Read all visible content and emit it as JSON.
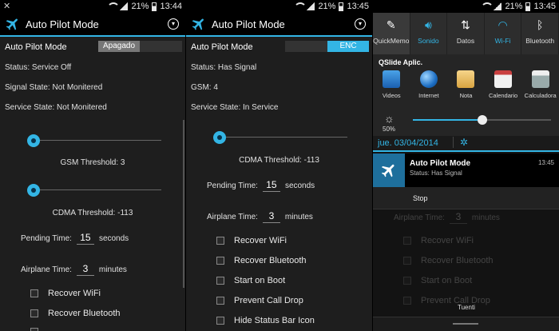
{
  "colors": {
    "accent": "#33b5e5",
    "background": "#1e1e1e"
  },
  "panel1": {
    "status": {
      "battery": "21%",
      "time": "13:44"
    },
    "title": "Auto Pilot Mode",
    "mode_label": "Auto Pilot Mode",
    "toggle": "Apagado",
    "status_line": "Status: Service Off",
    "signal_state": "Signal State: Not Monitered",
    "service_state": "Service State: Not Monitered",
    "gsm_threshold": "GSM Threshold: 3",
    "cdma_threshold": "CDMA Threshold: -113",
    "pending_label": "Pending Time:",
    "pending_value": "15",
    "pending_unit": "seconds",
    "airplane_label": "Airplane Time:",
    "airplane_value": "3",
    "airplane_unit": "minutes",
    "checks": [
      "Recover WiFi",
      "Recover Bluetooth"
    ]
  },
  "panel2": {
    "status": {
      "battery": "21%",
      "time": "13:45"
    },
    "title": "Auto Pilot Mode",
    "mode_label": "Auto Pilot Mode",
    "toggle": "ENC",
    "status_line": "Status: Has Signal",
    "gsm": "GSM: 4",
    "service_state": "Service State: In Service",
    "cdma_threshold": "CDMA Threshold: -113",
    "pending_label": "Pending Time:",
    "pending_value": "15",
    "pending_unit": "seconds",
    "airplane_label": "Airplane Time:",
    "airplane_value": "3",
    "airplane_unit": "minutes",
    "checks": [
      "Recover WiFi",
      "Recover Bluetooth",
      "Start on Boot",
      "Prevent Call Drop",
      "Hide Status Bar Icon"
    ]
  },
  "panel3": {
    "status": {
      "battery": "21%",
      "time": "13:45"
    },
    "quick_settings": [
      {
        "label": "QuickMemo",
        "icon": "quickmemo-icon"
      },
      {
        "label": "Sonido",
        "icon": "sound-icon"
      },
      {
        "label": "Datos",
        "icon": "data-icon"
      },
      {
        "label": "Wi-Fi",
        "icon": "wifi-icon"
      },
      {
        "label": "Bluetooth",
        "icon": "bluetooth-icon"
      }
    ],
    "qslide_title": "QSlide Aplic.",
    "apps": [
      "Videos",
      "Internet",
      "Nota",
      "Calendario",
      "Calculadora"
    ],
    "brightness": {
      "label": "50%",
      "value": 0.5
    },
    "date": "jue. 03/04/2014",
    "notification": {
      "title": "Auto Pilot Mode",
      "text": "Status: Has Signal",
      "time": "13:45"
    },
    "stop_label": "Stop",
    "behind": {
      "airplane_label": "Airplane Time:",
      "airplane_value": "3",
      "airplane_unit": "minutes",
      "checks": [
        "Recover WiFi",
        "Recover Bluetooth",
        "Start on Boot",
        "Prevent Call Drop"
      ]
    },
    "bottom_label": "Tuenti"
  }
}
